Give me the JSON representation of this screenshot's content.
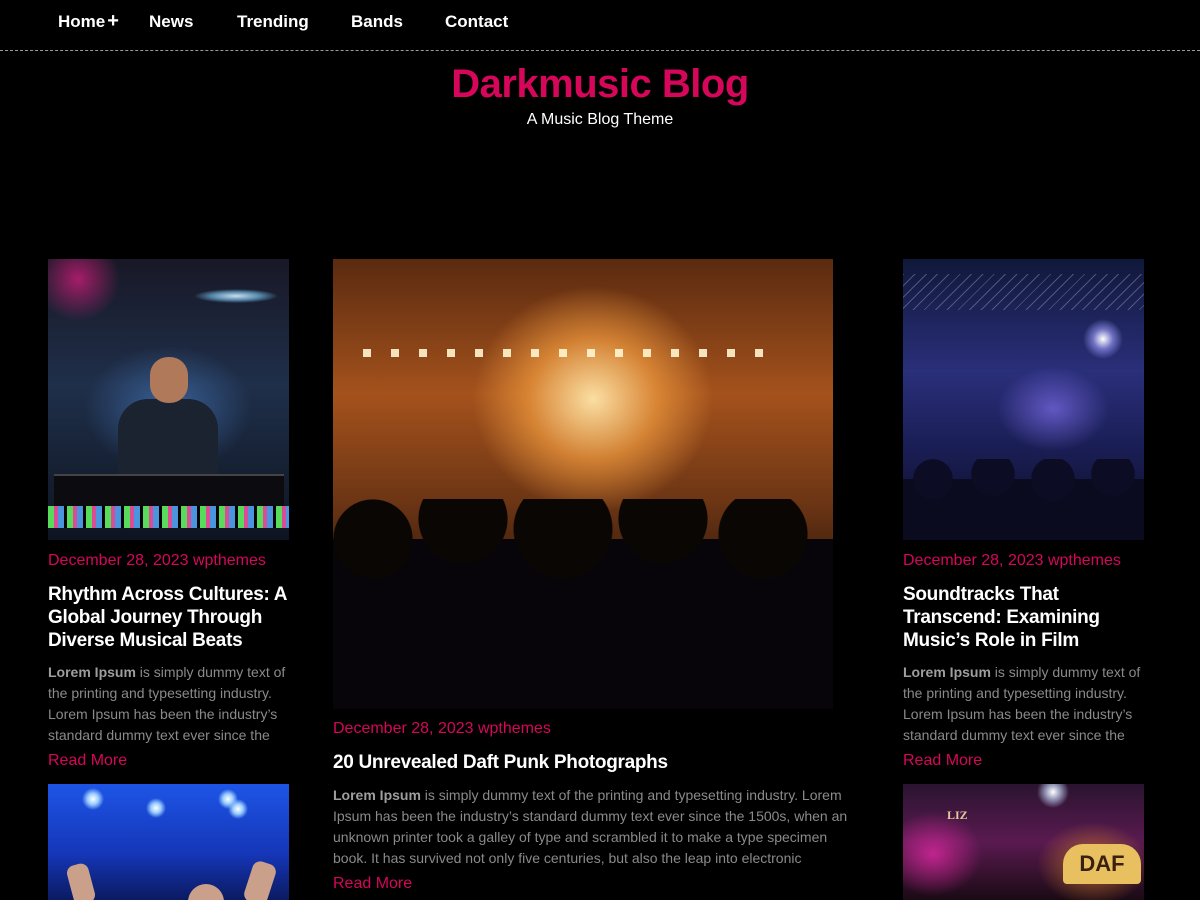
{
  "nav": {
    "items": [
      {
        "label": "Home"
      },
      {
        "label": "News"
      },
      {
        "label": "Trending"
      },
      {
        "label": "Bands"
      },
      {
        "label": "Contact"
      }
    ],
    "home_submenu_indicator": "+"
  },
  "header": {
    "site_title": "Darkmusic Blog",
    "tagline": "A Music Blog Theme"
  },
  "colors": {
    "accent": "#d6065a",
    "background": "#000000",
    "text": "#ffffff",
    "excerpt": "#8a8a8a"
  },
  "posts": [
    {
      "meta": "December 28, 2023 wpthemes",
      "title": "Rhythm Across Cultures: A Global Journey Through Diverse Musical Beats",
      "excerpt_bold": "Lorem Ipsum",
      "excerpt": " is simply dummy text of the printing and typesetting industry. Lorem Ipsum has been the industry’s standard dummy text ever since the",
      "read_more": "Read More"
    },
    {
      "meta": "December 28, 2023 wpthemes",
      "title": "20 Unrevealed Daft Punk Photographs",
      "excerpt_bold": "Lorem Ipsum",
      "excerpt": " is simply dummy text of the printing and typesetting industry. Lorem Ipsum has been the industry’s standard dummy text ever since the 1500s, when an unknown printer took a galley of type and scrambled it to make a type specimen book. It has survived not only five centuries, but also the leap into electronic",
      "read_more": "Read More"
    },
    {
      "meta": "December 28, 2023 wpthemes",
      "title": "Soundtracks That Transcend: Examining Music’s Role in Film",
      "excerpt_bold": "Lorem Ipsum",
      "excerpt": " is simply dummy text of the printing and typesetting industry. Lorem Ipsum has been the industry’s standard dummy text ever since the",
      "read_more": "Read More"
    }
  ],
  "images": {
    "post1": "dj-performing-image",
    "post2": "concert-crowd-image",
    "post3": "band-on-stage-image",
    "post4": "stage-lights-hands-image",
    "post5": "neon-club-image",
    "post5_sign_text": "LIZ",
    "post5_badge_text": "DAF"
  }
}
